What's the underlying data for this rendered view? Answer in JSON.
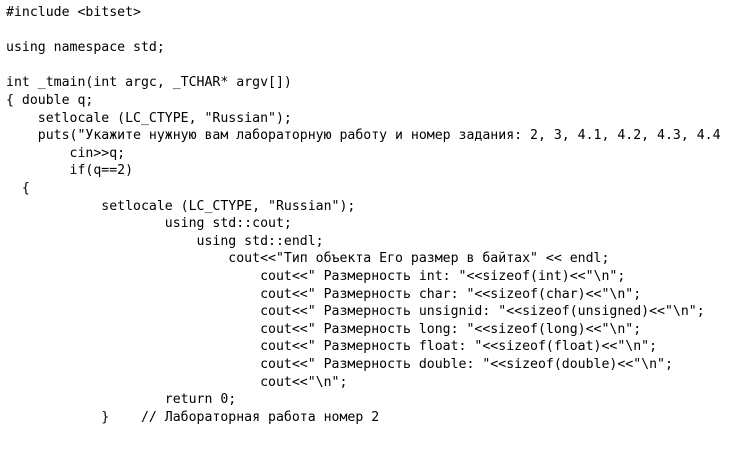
{
  "editor": {
    "lines": [
      "#include <bitset>",
      "",
      "using namespace std;",
      "",
      "int _tmain(int argc, _TCHAR* argv[])",
      "{ double q;",
      "    setlocale (LC_CTYPE, \"Russian\");",
      "    puts(\"Укажите нужную вам лабораторную работу и номер задания: 2, 3, 4.1, 4.2, 4.3, 4.4",
      "        cin>>q;",
      "        if(q==2)",
      "  {",
      "            setlocale (LC_CTYPE, \"Russian\");",
      "                    using std::cout;",
      "                        using std::endl;",
      "                            cout<<\"Тип объекта Его размер в байтах\" << endl;",
      "                                cout<<\" Размерность int: \"<<sizeof(int)<<\"\\n\";",
      "                                cout<<\" Размерность char: \"<<sizeof(char)<<\"\\n\";",
      "                                cout<<\" Размерность unsignid: \"<<sizeof(unsigned)<<\"\\n\";",
      "                                cout<<\" Размерность long: \"<<sizeof(long)<<\"\\n\";",
      "                                cout<<\" Размерность float: \"<<sizeof(float)<<\"\\n\";",
      "                                cout<<\" Размерность double: \"<<sizeof(double)<<\"\\n\";",
      "                                cout<<\"\\n\";",
      "                    return 0;",
      "            }    // Лабораторная работа номер 2"
    ]
  }
}
